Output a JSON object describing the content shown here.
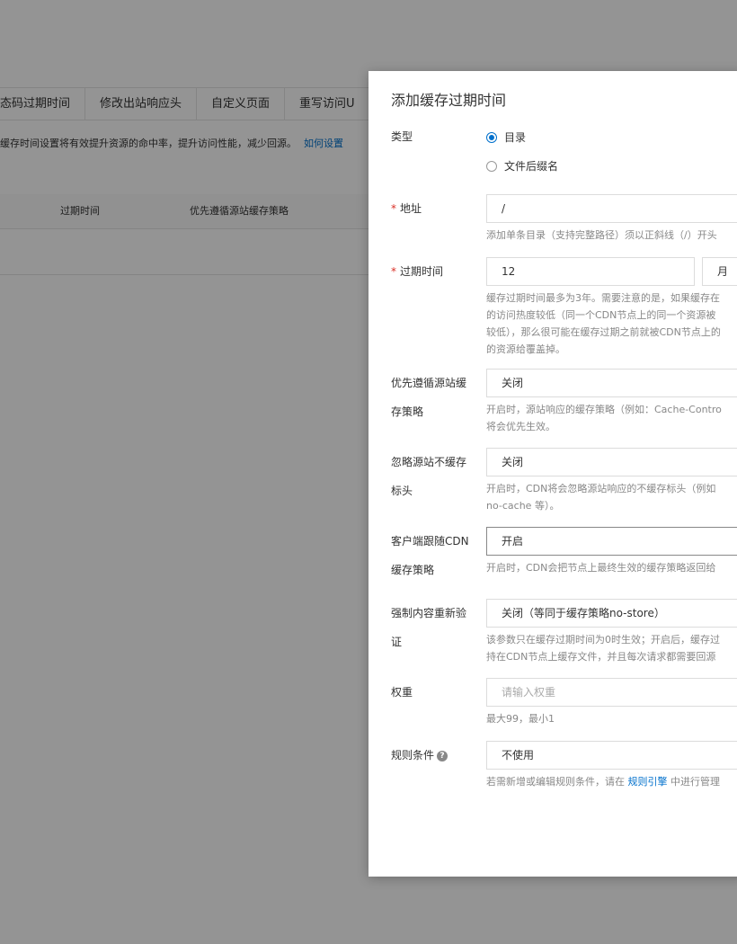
{
  "background": {
    "tabs": [
      "态码过期时间",
      "修改出站响应头",
      "自定义页面",
      "重写访问U"
    ],
    "description": "缓存时间设置将有效提升资源的命中率，提升访问性能，减少回源。",
    "description_link": "如何设置",
    "table_headers": [
      "过期时间",
      "优先遵循源站缓存策略"
    ]
  },
  "dialog": {
    "title": "添加缓存过期时间",
    "type": {
      "label": "类型",
      "options": [
        "目录",
        "文件后缀名"
      ],
      "selected": "目录"
    },
    "address": {
      "label": "地址",
      "value": "/",
      "help": "添加单条目录（支持完整路径）须以正斜线（/）开头"
    },
    "expire": {
      "label": "过期时间",
      "value": "12",
      "unit": "月",
      "help": [
        "缓存过期时间最多为3年。需要注意的是，如果缓存在",
        "的访问热度较低（同一个CDN节点上的同一个资源被",
        "较低），那么很可能在缓存过期之前就被CDN节点上的",
        "的资源给覆盖掉。"
      ]
    },
    "origin_priority": {
      "label_1": "优先遵循源站缓",
      "label_2": "存策略",
      "value": "关闭",
      "help": [
        "开启时，源站响应的缓存策略（例如：Cache-Contro",
        "将会优先生效。"
      ]
    },
    "ignore_nocache": {
      "label_1": "忽略源站不缓存",
      "label_2": "标头",
      "value": "关闭",
      "help": [
        "开启时，CDN将会忽略源站响应的不缓存标头（例如",
        "no-cache 等）。"
      ]
    },
    "client_follow": {
      "label_1": "客户端跟随CDN",
      "label_2": "缓存策略",
      "value": "开启",
      "help": "开启时，CDN会把节点上最终生效的缓存策略返回给"
    },
    "force_revalidate": {
      "label_1": "强制内容重新验",
      "label_2": "证",
      "value": "关闭（等同于缓存策略no-store）",
      "help": [
        "该参数只在缓存过期时间为0时生效；开启后，缓存过",
        "持在CDN节点上缓存文件，并且每次请求都需要回源"
      ]
    },
    "weight": {
      "label": "权重",
      "placeholder": "请输入权重",
      "help": "最大99，最小1"
    },
    "rule_condition": {
      "label": "规则条件",
      "value": "不使用",
      "help_pre": "若需新增或编辑规则条件，请在",
      "help_link": "规则引擎",
      "help_post": "中进行管理"
    }
  }
}
